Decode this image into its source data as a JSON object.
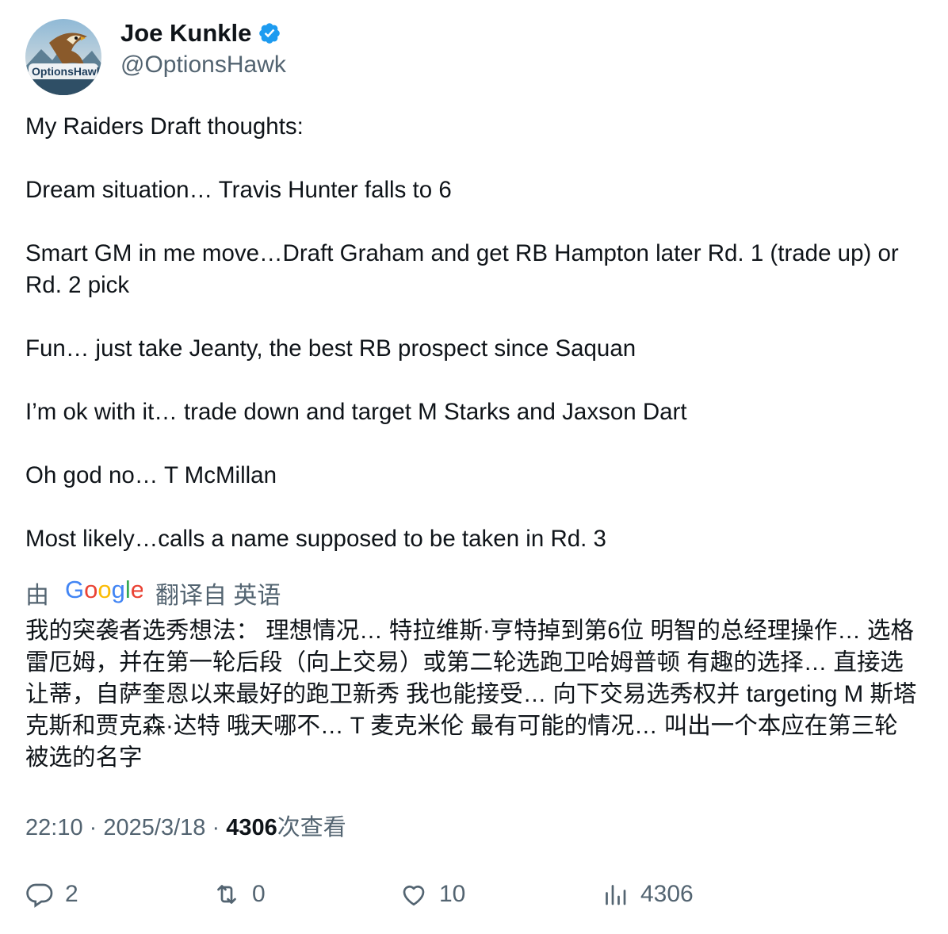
{
  "author": {
    "display_name": "Joe Kunkle",
    "handle": "@OptionsHawk",
    "avatar_icon": "hawk-avatar",
    "avatar_text": "OptionsHawk",
    "verified": true
  },
  "tweet": {
    "lines": [
      "My Raiders Draft thoughts:",
      "Dream situation… Travis Hunter falls to 6",
      "Smart GM in me move…Draft Graham and get RB Hampton later Rd. 1 (trade up) or Rd. 2 pick",
      "Fun… just take Jeanty, the best RB prospect since Saquan",
      "I’m ok with it… trade down and target M Starks and Jaxson Dart",
      "Oh god no… T McMillan",
      "Most likely…calls a name supposed to be taken in Rd. 3"
    ]
  },
  "translation": {
    "prefix": "由",
    "google": "Google",
    "suffix": "翻译自 英语",
    "text": "我的突袭者选秀想法： 理想情况… 特拉维斯·亨特掉到第6位 明智的总经理操作… 选格雷厄姆，并在第一轮后段（向上交易）或第二轮选跑卫哈姆普顿 有趣的选择… 直接选让蒂，自萨奎恩以来最好的跑卫新秀 我也能接受… 向下交易选秀权并 targeting M 斯塔克斯和贾克森·达特 哦天哪不… T 麦克米伦 最有可能的情况… 叫出一个本应在第三轮被选的名字"
  },
  "meta": {
    "time": "22:10",
    "sep1": "·",
    "date": "2025/3/18",
    "sep2": "·",
    "views_count": "4306",
    "views_label": "次查看"
  },
  "actions": {
    "reply": {
      "icon": "reply-icon",
      "count": "2"
    },
    "retweet": {
      "icon": "retweet-icon",
      "count": "0"
    },
    "like": {
      "icon": "heart-icon",
      "count": "10"
    },
    "views": {
      "icon": "bar-chart-icon",
      "count": "4306"
    }
  },
  "colors": {
    "text": "#0f1419",
    "secondary": "#536471",
    "verified": "#1d9bf0"
  }
}
